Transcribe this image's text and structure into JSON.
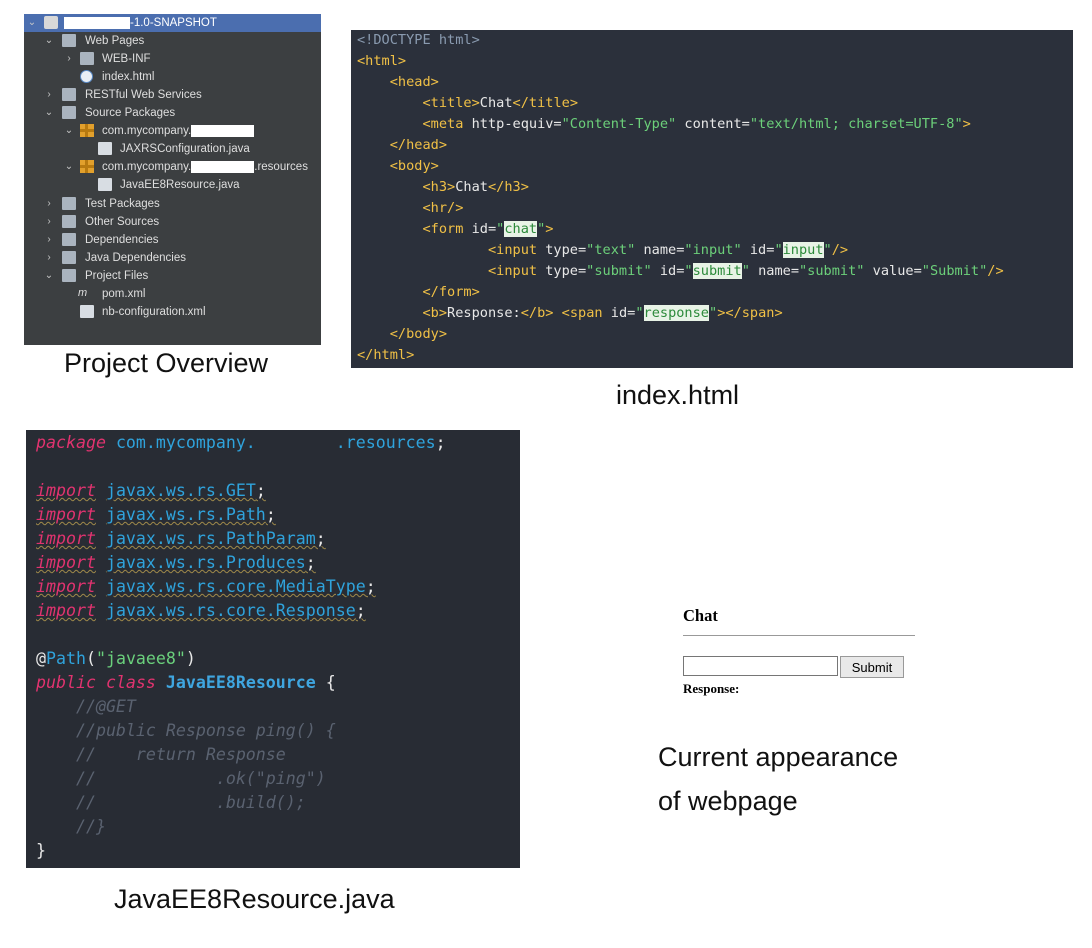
{
  "captions": {
    "project_overview": "Project Overview",
    "index_html": "index.html",
    "resource_java": "JavaEE8Resource.java",
    "appearance_line1": "Current appearance",
    "appearance_line2": "of webpage"
  },
  "tree": {
    "root_suffix": "-1.0-SNAPSHOT",
    "items": [
      {
        "label": "Web Pages"
      },
      {
        "label": "WEB-INF"
      },
      {
        "label": "index.html"
      },
      {
        "label": "RESTful Web Services"
      },
      {
        "label": "Source Packages"
      },
      {
        "label": "com.mycompany.",
        "suffix": ""
      },
      {
        "label": "JAXRSConfiguration.java"
      },
      {
        "label": "com.mycompany.",
        "suffix": ".resources"
      },
      {
        "label": "JavaEE8Resource.java"
      },
      {
        "label": "Test Packages"
      },
      {
        "label": "Other Sources"
      },
      {
        "label": "Dependencies"
      },
      {
        "label": "Java Dependencies"
      },
      {
        "label": "Project Files"
      },
      {
        "label": "pom.xml"
      },
      {
        "label": "nb-configuration.xml"
      }
    ]
  },
  "html_code": {
    "doctype": "<!DOCTYPE html>",
    "html_open": "<html>",
    "head_open": "<head>",
    "title_open": "<title>",
    "title_text": "Chat",
    "title_close": "</title>",
    "meta_open": "<meta",
    "meta_attr1": "http-equiv=",
    "meta_val1": "\"Content-Type\"",
    "meta_attr2": "content=",
    "meta_val2": "\"text/html; charset=UTF-8\"",
    "meta_close": ">",
    "head_close": "</head>",
    "body_open": "<body>",
    "h3_open": "<h3>",
    "h3_text": "Chat",
    "h3_close": "</h3>",
    "hr": "<hr/>",
    "form_open": "<form",
    "form_attr": "id=",
    "form_id": "chat",
    "input1": "<input",
    "input1_type_attr": "type=",
    "input1_type": "\"text\"",
    "input1_name_attr": "name=",
    "input1_name": "\"input\"",
    "input1_id_attr": "id=",
    "input1_id": "input",
    "input1_close": "/>",
    "input2": "<input",
    "input2_type_attr": "type=",
    "input2_type": "\"submit\"",
    "input2_id_attr": "id=",
    "input2_id": "submit",
    "input2_name_attr": "name=",
    "input2_name": "\"submit\"",
    "input2_value_attr": "value=",
    "input2_value": "\"Submit\"",
    "input2_close": "/>",
    "form_close": "</form>",
    "b_open": "<b>",
    "b_text": "Response:",
    "b_close": "</b>",
    "span_open": "<span",
    "span_attr": "id=",
    "span_id": "response",
    "span_close": "></span>",
    "body_close": "</body>",
    "html_close": "</html>"
  },
  "java_code": {
    "package_kw": "package",
    "package_name": "com.mycompany.",
    "package_suffix": ".resources",
    "imports": [
      {
        "kw": "import",
        "path": "javax.ws.rs.GET"
      },
      {
        "kw": "import",
        "path": "javax.ws.rs.Path"
      },
      {
        "kw": "import",
        "path": "javax.ws.rs.PathParam"
      },
      {
        "kw": "import",
        "path": "javax.ws.rs.Produces"
      },
      {
        "kw": "import",
        "path": "javax.ws.rs.core.MediaType"
      },
      {
        "kw": "import",
        "path": "javax.ws.rs.core.Response"
      }
    ],
    "annotation_at": "@",
    "annotation_name": "Path",
    "annotation_value": "\"javaee8\"",
    "class_public": "public",
    "class_kw": "class",
    "class_name": "JavaEE8Resource",
    "class_brace": "{",
    "comments": [
      "//@GET",
      "//public Response ping() {",
      "//    return Response",
      "//            .ok(\"ping\")",
      "//            .build();",
      "//}"
    ],
    "close_brace": "}"
  },
  "preview": {
    "heading": "Chat",
    "submit_label": "Submit",
    "input_value": "",
    "response_label": "Response:"
  }
}
